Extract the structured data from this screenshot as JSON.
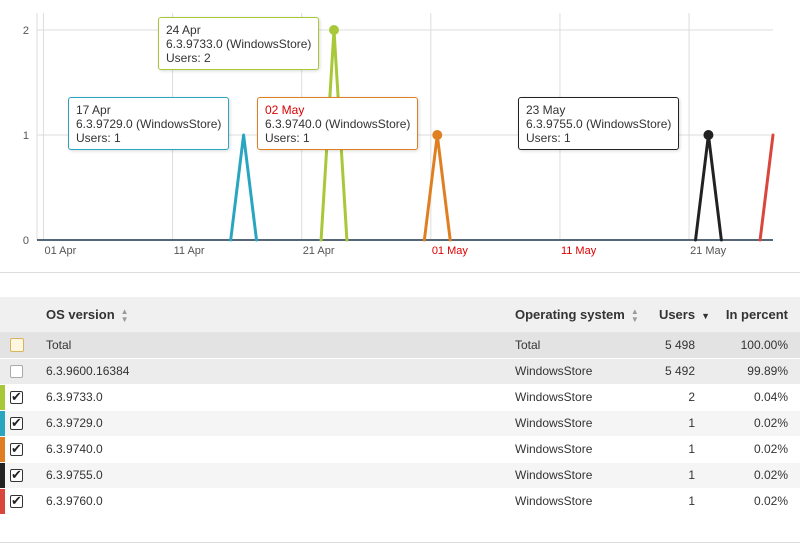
{
  "chart_data": {
    "type": "line",
    "x_ticks": [
      {
        "label": "01 Apr",
        "day": 0,
        "weekend": false
      },
      {
        "label": "11 Apr",
        "day": 10,
        "weekend": false
      },
      {
        "label": "21 Apr",
        "day": 20,
        "weekend": false
      },
      {
        "label": "01 May",
        "day": 30,
        "weekend": true
      },
      {
        "label": "11 May",
        "day": 40,
        "weekend": true
      },
      {
        "label": "21 May",
        "day": 50,
        "weekend": false
      }
    ],
    "y_ticks": [
      "0",
      "1",
      "2"
    ],
    "ylim": [
      0,
      2
    ],
    "xlim": [
      -0.5,
      56.5
    ],
    "grid": true,
    "series": [
      {
        "color": "#2aa5c0",
        "points": [
          [
            14.5,
            0
          ],
          [
            15.5,
            1
          ],
          [
            16.5,
            0
          ]
        ]
      },
      {
        "color": "#a8c83a",
        "points": [
          [
            21.5,
            0
          ],
          [
            22.5,
            2
          ],
          [
            23.5,
            0
          ]
        ]
      },
      {
        "color": "#e07f22",
        "points": [
          [
            29.5,
            0
          ],
          [
            30.5,
            1
          ],
          [
            31.5,
            0
          ]
        ]
      },
      {
        "color": "#222222",
        "points": [
          [
            50.5,
            0
          ],
          [
            51.5,
            1
          ],
          [
            52.5,
            0
          ]
        ]
      },
      {
        "color": "#d9463c",
        "points": [
          [
            55.5,
            0
          ],
          [
            56.5,
            1
          ]
        ]
      }
    ],
    "markers": [
      {
        "day": 22.5,
        "value": 2,
        "color": "#a8c83a"
      },
      {
        "day": 30.5,
        "value": 1,
        "color": "#e07f22"
      },
      {
        "day": 51.5,
        "value": 1,
        "color": "#222222"
      }
    ],
    "tooltips": [
      {
        "date": "17 Apr",
        "version": "6.3.9729.0 (WindowsStore)",
        "users": "Users: 1",
        "border": "#2aa5c0",
        "weekend": false
      },
      {
        "date": "24 Apr",
        "version": "6.3.9733.0 (WindowsStore)",
        "users": "Users: 2",
        "border": "#a8c83a",
        "weekend": false
      },
      {
        "date": "02 May",
        "version": "6.3.9740.0 (WindowsStore)",
        "users": "Users: 1",
        "border": "#e07f22",
        "weekend": true
      },
      {
        "date": "23 May",
        "version": "6.3.9755.0 (WindowsStore)",
        "users": "Users: 1",
        "border": "#222222",
        "weekend": false
      }
    ]
  },
  "table": {
    "headers": {
      "os_version": "OS version",
      "operating_system": "Operating system",
      "users": "Users",
      "percent": "In percent"
    },
    "rows": [
      {
        "os": "Total",
        "system": "Total",
        "users": "5 498",
        "percent": "100.00%"
      },
      {
        "os": "6.3.9600.16384",
        "system": "WindowsStore",
        "users": "5 492",
        "percent": "99.89%"
      },
      {
        "os": "6.3.9733.0",
        "system": "WindowsStore",
        "users": "2",
        "percent": "0.04%",
        "color": "#a8c83a"
      },
      {
        "os": "6.3.9729.0",
        "system": "WindowsStore",
        "users": "1",
        "percent": "0.02%",
        "color": "#2aa5c0"
      },
      {
        "os": "6.3.9740.0",
        "system": "WindowsStore",
        "users": "1",
        "percent": "0.02%",
        "color": "#e07f22"
      },
      {
        "os": "6.3.9755.0",
        "system": "WindowsStore",
        "users": "1",
        "percent": "0.02%",
        "color": "#222222"
      },
      {
        "os": "6.3.9760.0",
        "system": "WindowsStore",
        "users": "1",
        "percent": "0.02%",
        "color": "#d9463c"
      }
    ]
  }
}
